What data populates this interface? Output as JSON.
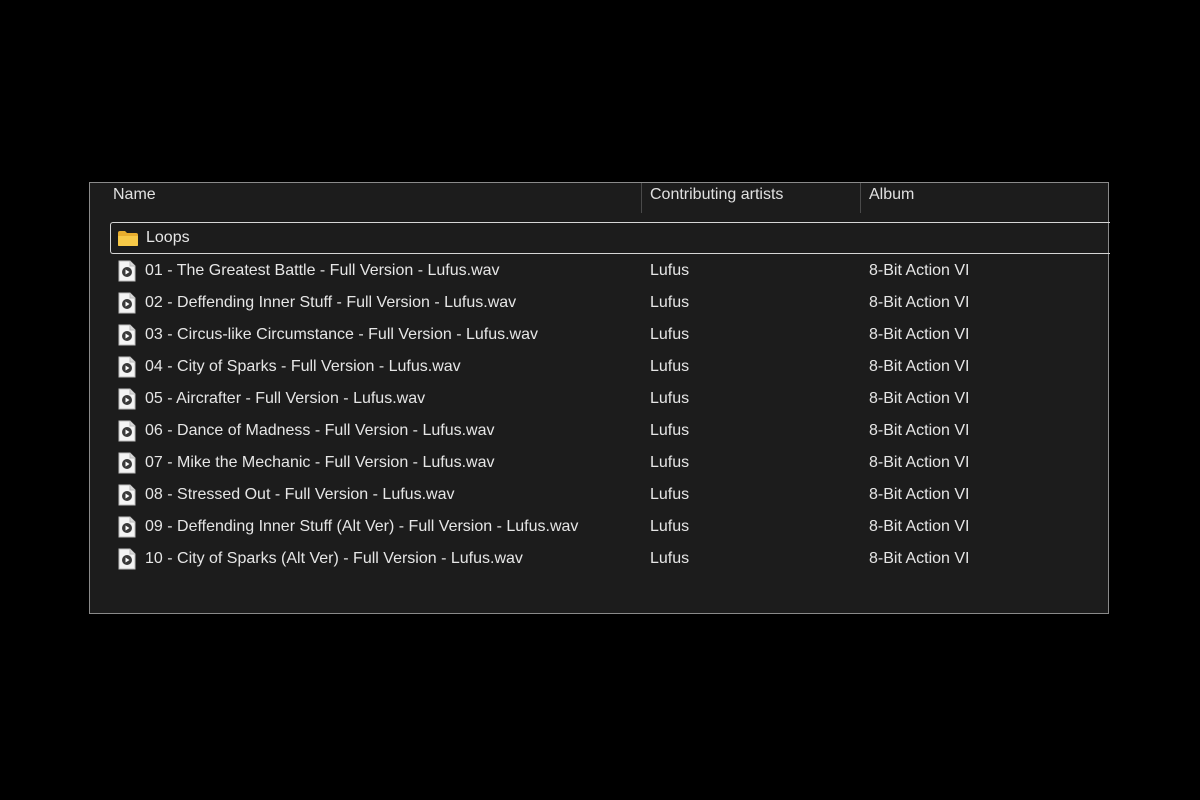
{
  "columns": {
    "name": "Name",
    "artists": "Contributing artists",
    "album": "Album"
  },
  "folder": {
    "name": "Loops",
    "icon": "folder-icon"
  },
  "files": [
    {
      "name": "01 - The Greatest Battle - Full Version - Lufus.wav",
      "artist": "Lufus",
      "album": "8-Bit Action VI"
    },
    {
      "name": "02 - Deffending Inner Stuff - Full Version - Lufus.wav",
      "artist": "Lufus",
      "album": "8-Bit Action VI"
    },
    {
      "name": "03 - Circus-like Circumstance - Full Version - Lufus.wav",
      "artist": "Lufus",
      "album": "8-Bit Action VI"
    },
    {
      "name": "04 - City of Sparks - Full Version - Lufus.wav",
      "artist": "Lufus",
      "album": "8-Bit Action VI"
    },
    {
      "name": "05 - Aircrafter - Full Version - Lufus.wav",
      "artist": "Lufus",
      "album": "8-Bit Action VI"
    },
    {
      "name": "06 - Dance of Madness - Full Version - Lufus.wav",
      "artist": "Lufus",
      "album": "8-Bit Action VI"
    },
    {
      "name": "07 - Mike the Mechanic - Full Version - Lufus.wav",
      "artist": "Lufus",
      "album": "8-Bit Action VI"
    },
    {
      "name": "08 - Stressed Out - Full Version - Lufus.wav",
      "artist": "Lufus",
      "album": "8-Bit Action VI"
    },
    {
      "name": "09 - Deffending Inner Stuff (Alt Ver) - Full Version - Lufus.wav",
      "artist": "Lufus",
      "album": "8-Bit Action VI"
    },
    {
      "name": "10 - City of Sparks (Alt Ver) - Full Version - Lufus.wav",
      "artist": "Lufus",
      "album": "8-Bit Action VI"
    }
  ],
  "colors": {
    "background": "#000000",
    "panel": "#1c1c1c",
    "folder": "#f2c14e",
    "audio_badge": "#c0392b"
  }
}
